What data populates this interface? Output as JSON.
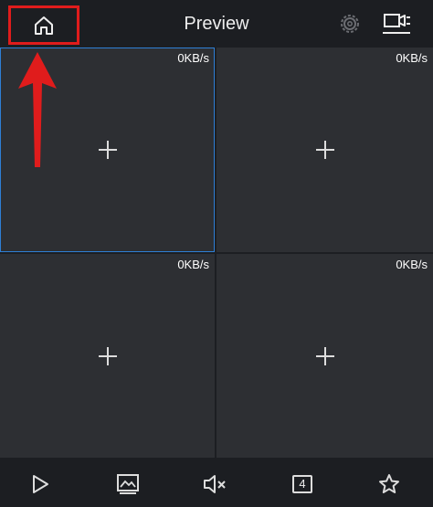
{
  "header": {
    "title": "Preview",
    "home_icon": "home-icon",
    "settings_icon": "gear-icon",
    "camera_icon": "video-camera-list-icon"
  },
  "annotation": {
    "highlight_color": "#e01c1c",
    "arrow_color": "#e01c1c"
  },
  "grid": {
    "tiles": [
      {
        "rate": "0KB/s",
        "selected": true
      },
      {
        "rate": "0KB/s",
        "selected": false
      },
      {
        "rate": "0KB/s",
        "selected": false
      },
      {
        "rate": "0KB/s",
        "selected": false
      }
    ],
    "selected_color": "#2e7fd6"
  },
  "toolbar": {
    "play_icon": "play-icon",
    "picture_icon": "image-icon",
    "mute_icon": "speaker-mute-icon",
    "split_count": "4",
    "favorite_icon": "star-icon"
  }
}
